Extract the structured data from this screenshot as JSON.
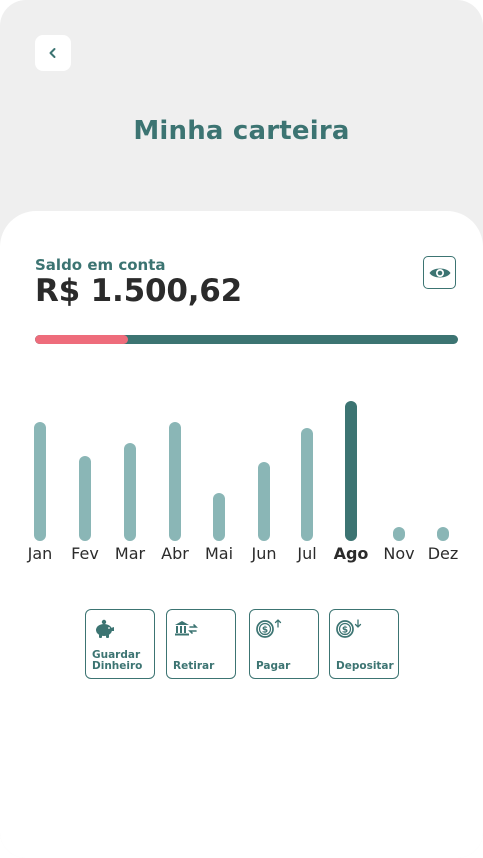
{
  "header": {
    "back_icon": "chevron-left-icon",
    "title": "Minha carteira"
  },
  "balance": {
    "label": "Saldo em conta",
    "value": "R$ 1.500,62",
    "visibility_icon": "eye-icon",
    "progress_fraction": 0.22
  },
  "colors": {
    "primary": "#3c7472",
    "bar_inactive": "#8ab6b6",
    "progress_accent": "#ee6c7b",
    "header_bg": "#efefef"
  },
  "chart_data": {
    "type": "bar",
    "categories": [
      "Jan",
      "Fev",
      "Mar",
      "Abr",
      "Mai",
      "Jun",
      "Jul",
      "Ago",
      "Nov",
      "Dez"
    ],
    "values": [
      119,
      85,
      98,
      119,
      48,
      79,
      113,
      140,
      14,
      14
    ],
    "highlighted": "Ago",
    "ylim": [
      0,
      140
    ],
    "grid": false
  },
  "actions": [
    {
      "label": "Guardar\nDinheiro",
      "icon": "piggy-bank-icon"
    },
    {
      "label": "Retirar",
      "icon": "bank-transfer-icon"
    },
    {
      "label": "Pagar",
      "icon": "coin-up-icon"
    },
    {
      "label": "Depositar",
      "icon": "coin-down-icon"
    }
  ]
}
